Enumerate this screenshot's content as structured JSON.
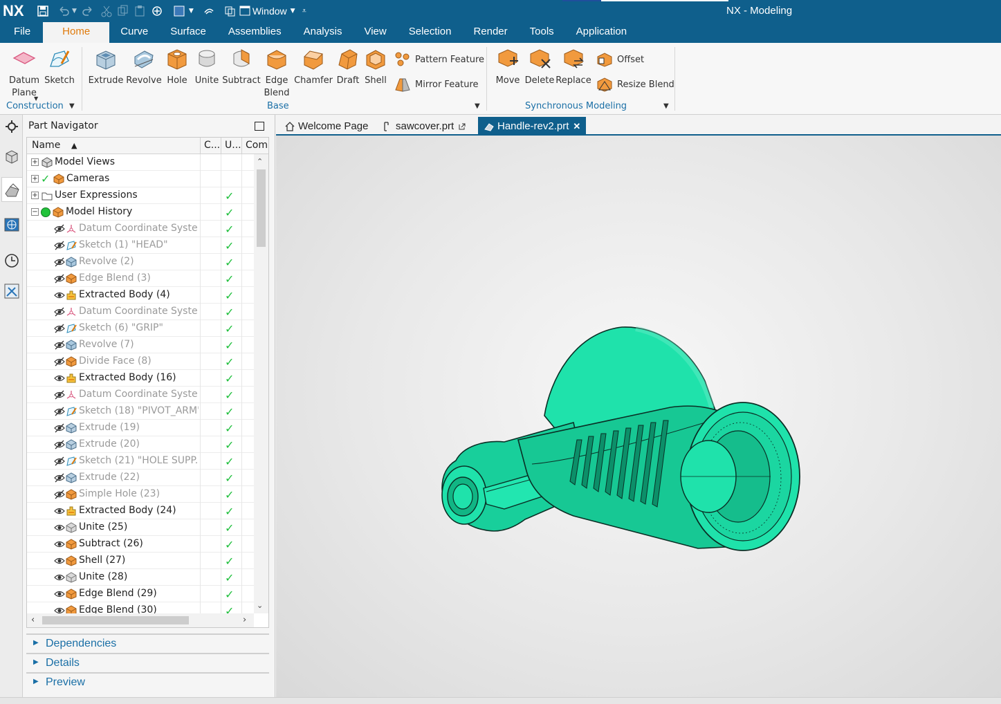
{
  "app": {
    "logo": "NX",
    "title": "NX - Modeling",
    "window_menu": "Window"
  },
  "menubar": {
    "items": [
      "File",
      "Home",
      "Curve",
      "Surface",
      "Assemblies",
      "Analysis",
      "View",
      "Selection",
      "Render",
      "Tools",
      "Application"
    ],
    "active": "Home"
  },
  "ribbon": {
    "construction": {
      "label": "Construction",
      "datum_plane": "Datum\nPlane",
      "sketch": "Sketch"
    },
    "base": {
      "label": "Base",
      "extrude": "Extrude",
      "revolve": "Revolve",
      "hole": "Hole",
      "unite": "Unite",
      "subtract": "Subtract",
      "edge_blend": "Edge\nBlend",
      "chamfer": "Chamfer",
      "draft": "Draft",
      "shell": "Shell",
      "pattern_feature": "Pattern Feature",
      "mirror_feature": "Mirror Feature"
    },
    "sync": {
      "label": "Synchronous Modeling",
      "move": "Move",
      "delete": "Delete",
      "replace": "Replace",
      "offset": "Offset",
      "resize_blend": "Resize Blend"
    }
  },
  "navigator": {
    "title": "Part Navigator",
    "columns": {
      "name": "Name",
      "c": "C...",
      "u": "U...",
      "com": "Com"
    },
    "rows": [
      {
        "label": "Model Views",
        "level": 0,
        "expander": "+",
        "icon": "model-views-icon",
        "check": false,
        "dim": false
      },
      {
        "label": "Cameras",
        "level": 0,
        "expander": "+",
        "icon": "cameras-icon",
        "check": false,
        "dim": false,
        "pre_check": true
      },
      {
        "label": "User Expressions",
        "level": 0,
        "expander": "+",
        "icon": "folder-icon",
        "check": true,
        "dim": false
      },
      {
        "label": "Model History",
        "level": 0,
        "expander": "−",
        "icon": "model-history-icon",
        "check": true,
        "dim": false
      },
      {
        "label": "Datum Coordinate Syste...",
        "level": 1,
        "icon": "datum-csys-icon",
        "check": true,
        "dim": true,
        "hidden": true
      },
      {
        "label": "Sketch (1) \"HEAD\"",
        "level": 1,
        "icon": "sketch-icon",
        "check": true,
        "dim": true,
        "hidden": true
      },
      {
        "label": "Revolve (2)",
        "level": 1,
        "icon": "revolve-icon",
        "check": true,
        "dim": true,
        "hidden": true
      },
      {
        "label": "Edge Blend (3)",
        "level": 1,
        "icon": "edge-blend-icon",
        "check": true,
        "dim": true,
        "hidden": true
      },
      {
        "label": "Extracted Body (4)",
        "level": 1,
        "icon": "extracted-body-icon",
        "check": true,
        "dim": false,
        "hidden": false
      },
      {
        "label": "Datum Coordinate Syste...",
        "level": 1,
        "icon": "datum-csys-icon",
        "check": true,
        "dim": true,
        "hidden": true
      },
      {
        "label": "Sketch (6) \"GRIP\"",
        "level": 1,
        "icon": "sketch-icon",
        "check": true,
        "dim": true,
        "hidden": true
      },
      {
        "label": "Revolve (7)",
        "level": 1,
        "icon": "revolve-icon",
        "check": true,
        "dim": true,
        "hidden": true
      },
      {
        "label": "Divide Face (8)",
        "level": 1,
        "icon": "divide-face-icon",
        "check": true,
        "dim": true,
        "hidden": true
      },
      {
        "label": "Extracted Body (16)",
        "level": 1,
        "icon": "extracted-body-icon",
        "check": true,
        "dim": false,
        "hidden": false
      },
      {
        "label": "Datum Coordinate Syste...",
        "level": 1,
        "icon": "datum-csys-icon",
        "check": true,
        "dim": true,
        "hidden": true
      },
      {
        "label": "Sketch (18) \"PIVOT_ARM\"",
        "level": 1,
        "icon": "sketch-icon",
        "check": true,
        "dim": true,
        "hidden": true
      },
      {
        "label": "Extrude (19)",
        "level": 1,
        "icon": "extrude-icon",
        "check": true,
        "dim": true,
        "hidden": true
      },
      {
        "label": "Extrude (20)",
        "level": 1,
        "icon": "extrude-icon",
        "check": true,
        "dim": true,
        "hidden": true
      },
      {
        "label": "Sketch (21) \"HOLE SUPP...",
        "level": 1,
        "icon": "sketch-icon",
        "check": true,
        "dim": true,
        "hidden": true
      },
      {
        "label": "Extrude (22)",
        "level": 1,
        "icon": "extrude-icon",
        "check": true,
        "dim": true,
        "hidden": true
      },
      {
        "label": "Simple Hole (23)",
        "level": 1,
        "icon": "hole-icon",
        "check": true,
        "dim": true,
        "hidden": true
      },
      {
        "label": "Extracted Body (24)",
        "level": 1,
        "icon": "extracted-body-icon",
        "check": true,
        "dim": false,
        "hidden": false
      },
      {
        "label": "Unite (25)",
        "level": 1,
        "icon": "unite-icon",
        "check": true,
        "dim": false,
        "hidden": false
      },
      {
        "label": "Subtract (26)",
        "level": 1,
        "icon": "subtract-icon",
        "check": true,
        "dim": false,
        "hidden": false
      },
      {
        "label": "Shell (27)",
        "level": 1,
        "icon": "shell-icon",
        "check": true,
        "dim": false,
        "hidden": false
      },
      {
        "label": "Unite (28)",
        "level": 1,
        "icon": "unite-icon",
        "check": true,
        "dim": false,
        "hidden": false
      },
      {
        "label": "Edge Blend (29)",
        "level": 1,
        "icon": "edge-blend-icon",
        "check": true,
        "dim": false,
        "hidden": false
      },
      {
        "label": "Edge Blend (30)",
        "level": 1,
        "icon": "edge-blend-icon",
        "check": true,
        "dim": false,
        "hidden": false
      }
    ],
    "sections": [
      "Dependencies",
      "Details",
      "Preview"
    ]
  },
  "tabs": [
    {
      "label": "Welcome Page",
      "icon": "home-icon",
      "active": false
    },
    {
      "label": "sawcover.prt",
      "icon": "part-icon",
      "active": false
    },
    {
      "label": "Handle-rev2.prt",
      "icon": "part-active-icon",
      "active": true,
      "close": "✕"
    }
  ],
  "colors": {
    "brand": "#0f5f8c",
    "accent": "#e07a0b",
    "model": "#1ee0a9",
    "check": "#1fbf3c",
    "link": "#1a6fa6"
  }
}
